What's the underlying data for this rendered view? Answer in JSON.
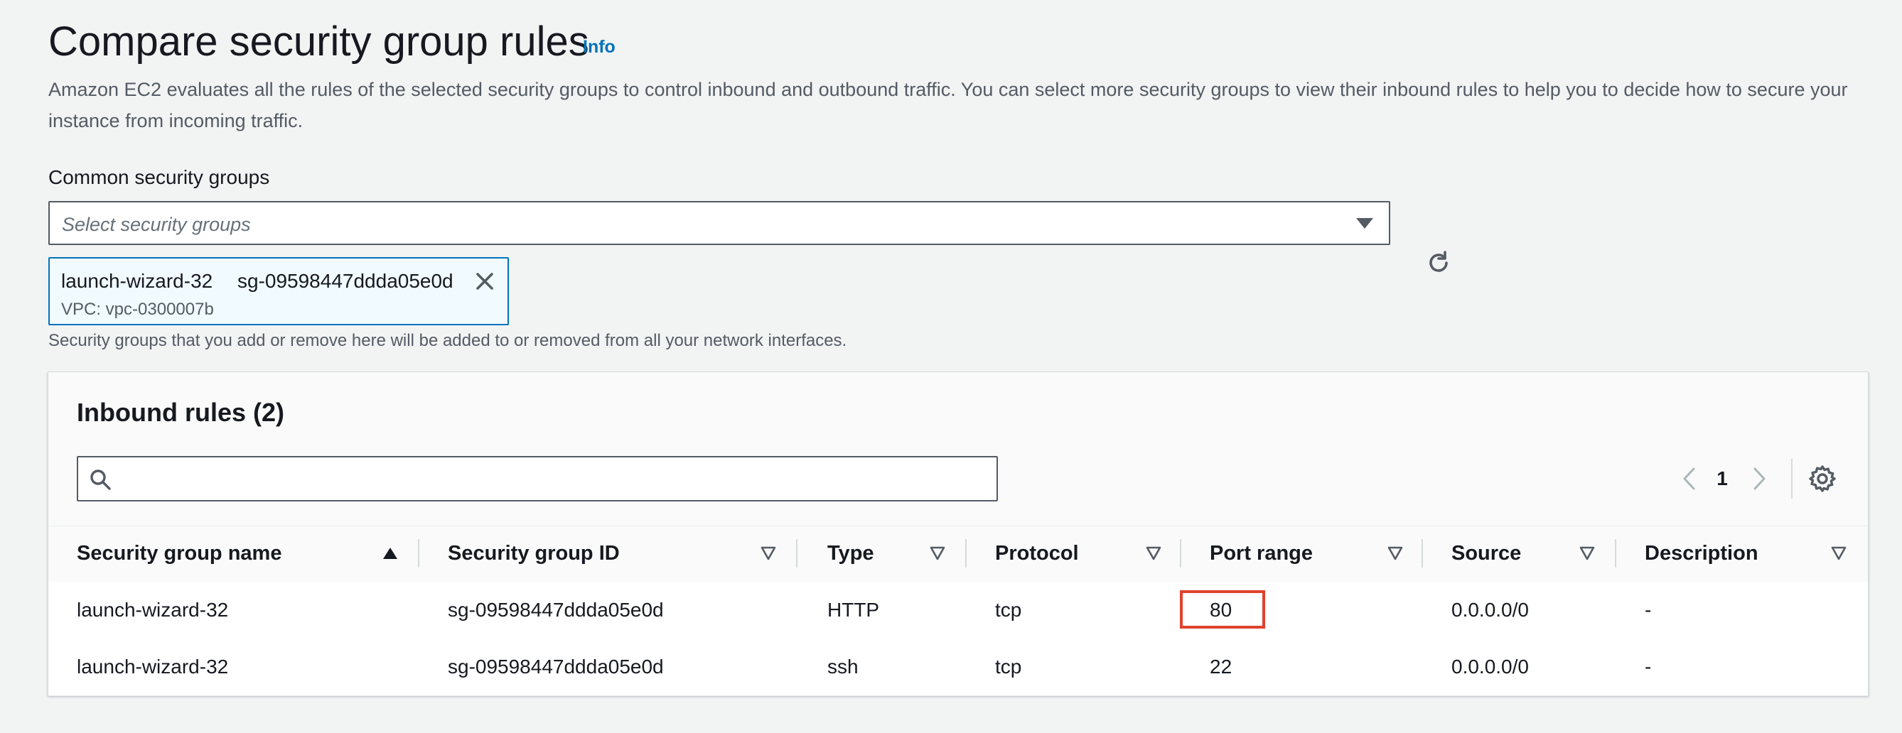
{
  "header": {
    "title": "Compare security group rules",
    "info_label": "Info",
    "description": "Amazon EC2 evaluates all the rules of the selected security groups to control inbound and outbound traffic. You can select more security groups to view their inbound rules to help you to decide how to secure your instance from incoming traffic."
  },
  "security_groups": {
    "label": "Common security groups",
    "placeholder": "Select security groups",
    "selected": [
      {
        "name": "launch-wizard-32",
        "id": "sg-09598447ddda05e0d",
        "vpc": "VPC: vpc-0300007b"
      }
    ],
    "hint": "Security groups that you add or remove here will be added to or removed from all your network interfaces."
  },
  "inbound_rules": {
    "title": "Inbound rules (2)",
    "search_value": "",
    "page": "1",
    "columns": [
      "Security group name",
      "Security group ID",
      "Type",
      "Protocol",
      "Port range",
      "Source",
      "Description"
    ],
    "rows": [
      [
        "launch-wizard-32",
        "sg-09598447ddda05e0d",
        "HTTP",
        "tcp",
        "80",
        "0.0.0.0/0",
        "-"
      ],
      [
        "launch-wizard-32",
        "sg-09598447ddda05e0d",
        "ssh",
        "tcp",
        "22",
        "0.0.0.0/0",
        "-"
      ]
    ],
    "highlighted_cell": "80"
  },
  "icons": [
    "refresh-icon",
    "close-icon",
    "search-icon",
    "chevron-left-icon",
    "chevron-right-icon",
    "settings-gear-icon",
    "sort-ascending-icon",
    "sort-descending-icon"
  ],
  "colors": {
    "accent": "#0073bb",
    "highlight_border": "#e0422c",
    "background": "#f2f3f3"
  }
}
